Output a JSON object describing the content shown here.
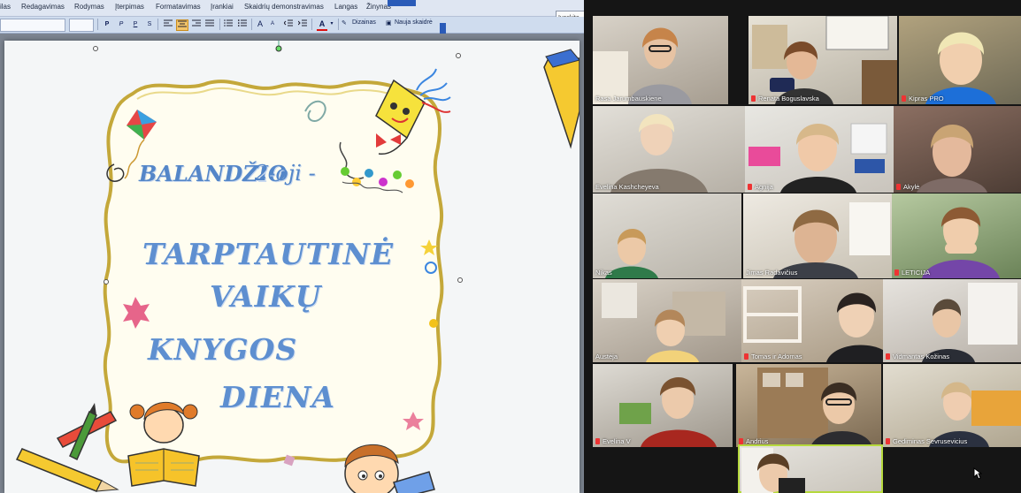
{
  "window": {
    "menu": [
      "ilas",
      "Redagavimas",
      "Rodymas",
      "Įterpimas",
      "Formatavimas",
      "Įrankiai",
      "Skaidrių demonstravimas",
      "Langas",
      "Žinynas"
    ],
    "search_placeholder": "Įveskite",
    "toolbar": {
      "bold": "P",
      "italic": "P",
      "underline": "P",
      "shadow": "S",
      "font_color": "A",
      "design_label": "Dizainas",
      "new_slide_label": "Nauja skaidrė"
    }
  },
  "slide": {
    "date_day": "BALANDŽIO",
    "date_num": "2-oji -",
    "title_lines": [
      "TARPTAUTINĖ",
      "VAIKŲ",
      "KNYGOS",
      "DIENA"
    ]
  },
  "gallery": {
    "participants": [
      {
        "name": "Rasa Jarumbauskiene",
        "muted": false
      },
      {
        "name": "Renata Boguslavska",
        "muted": true
      },
      {
        "name": "Kipras PRO",
        "muted": true
      },
      {
        "name": "Evelina Kashcheyeva",
        "muted": false
      },
      {
        "name": "Agnija",
        "muted": true
      },
      {
        "name": "Akylė",
        "muted": true
      },
      {
        "name": "Nikas",
        "muted": false
      },
      {
        "name": "Jimas Radavičius",
        "muted": false
      },
      {
        "name": "LETICIJA",
        "muted": true
      },
      {
        "name": "Austėja",
        "muted": false
      },
      {
        "name": "Tomas ir Adomas",
        "muted": true
      },
      {
        "name": "Vidmantas Kožinas",
        "muted": true
      },
      {
        "name": "Evelina V",
        "muted": true
      },
      {
        "name": "Andrius",
        "muted": true
      },
      {
        "name": "Gediminas Sevrusevicius",
        "muted": true
      },
      {
        "name": "",
        "muted": false
      }
    ]
  },
  "colors": {
    "title_text": "#5e8fd0",
    "frame_gold": "#b59a2c",
    "active_speaker": "#b6d93d",
    "muted_icon": "#e33333"
  }
}
